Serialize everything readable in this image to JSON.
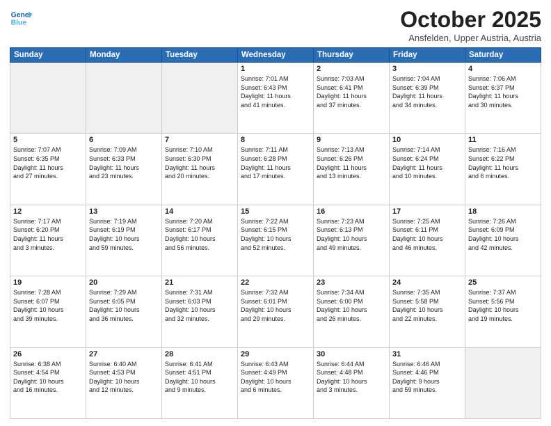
{
  "header": {
    "logo_line1": "General",
    "logo_line2": "Blue",
    "month": "October 2025",
    "location": "Ansfelden, Upper Austria, Austria"
  },
  "weekdays": [
    "Sunday",
    "Monday",
    "Tuesday",
    "Wednesday",
    "Thursday",
    "Friday",
    "Saturday"
  ],
  "weeks": [
    [
      {
        "day": "",
        "info": ""
      },
      {
        "day": "",
        "info": ""
      },
      {
        "day": "",
        "info": ""
      },
      {
        "day": "1",
        "info": "Sunrise: 7:01 AM\nSunset: 6:43 PM\nDaylight: 11 hours\nand 41 minutes."
      },
      {
        "day": "2",
        "info": "Sunrise: 7:03 AM\nSunset: 6:41 PM\nDaylight: 11 hours\nand 37 minutes."
      },
      {
        "day": "3",
        "info": "Sunrise: 7:04 AM\nSunset: 6:39 PM\nDaylight: 11 hours\nand 34 minutes."
      },
      {
        "day": "4",
        "info": "Sunrise: 7:06 AM\nSunset: 6:37 PM\nDaylight: 11 hours\nand 30 minutes."
      }
    ],
    [
      {
        "day": "5",
        "info": "Sunrise: 7:07 AM\nSunset: 6:35 PM\nDaylight: 11 hours\nand 27 minutes."
      },
      {
        "day": "6",
        "info": "Sunrise: 7:09 AM\nSunset: 6:33 PM\nDaylight: 11 hours\nand 23 minutes."
      },
      {
        "day": "7",
        "info": "Sunrise: 7:10 AM\nSunset: 6:30 PM\nDaylight: 11 hours\nand 20 minutes."
      },
      {
        "day": "8",
        "info": "Sunrise: 7:11 AM\nSunset: 6:28 PM\nDaylight: 11 hours\nand 17 minutes."
      },
      {
        "day": "9",
        "info": "Sunrise: 7:13 AM\nSunset: 6:26 PM\nDaylight: 11 hours\nand 13 minutes."
      },
      {
        "day": "10",
        "info": "Sunrise: 7:14 AM\nSunset: 6:24 PM\nDaylight: 11 hours\nand 10 minutes."
      },
      {
        "day": "11",
        "info": "Sunrise: 7:16 AM\nSunset: 6:22 PM\nDaylight: 11 hours\nand 6 minutes."
      }
    ],
    [
      {
        "day": "12",
        "info": "Sunrise: 7:17 AM\nSunset: 6:20 PM\nDaylight: 11 hours\nand 3 minutes."
      },
      {
        "day": "13",
        "info": "Sunrise: 7:19 AM\nSunset: 6:19 PM\nDaylight: 10 hours\nand 59 minutes."
      },
      {
        "day": "14",
        "info": "Sunrise: 7:20 AM\nSunset: 6:17 PM\nDaylight: 10 hours\nand 56 minutes."
      },
      {
        "day": "15",
        "info": "Sunrise: 7:22 AM\nSunset: 6:15 PM\nDaylight: 10 hours\nand 52 minutes."
      },
      {
        "day": "16",
        "info": "Sunrise: 7:23 AM\nSunset: 6:13 PM\nDaylight: 10 hours\nand 49 minutes."
      },
      {
        "day": "17",
        "info": "Sunrise: 7:25 AM\nSunset: 6:11 PM\nDaylight: 10 hours\nand 46 minutes."
      },
      {
        "day": "18",
        "info": "Sunrise: 7:26 AM\nSunset: 6:09 PM\nDaylight: 10 hours\nand 42 minutes."
      }
    ],
    [
      {
        "day": "19",
        "info": "Sunrise: 7:28 AM\nSunset: 6:07 PM\nDaylight: 10 hours\nand 39 minutes."
      },
      {
        "day": "20",
        "info": "Sunrise: 7:29 AM\nSunset: 6:05 PM\nDaylight: 10 hours\nand 36 minutes."
      },
      {
        "day": "21",
        "info": "Sunrise: 7:31 AM\nSunset: 6:03 PM\nDaylight: 10 hours\nand 32 minutes."
      },
      {
        "day": "22",
        "info": "Sunrise: 7:32 AM\nSunset: 6:01 PM\nDaylight: 10 hours\nand 29 minutes."
      },
      {
        "day": "23",
        "info": "Sunrise: 7:34 AM\nSunset: 6:00 PM\nDaylight: 10 hours\nand 26 minutes."
      },
      {
        "day": "24",
        "info": "Sunrise: 7:35 AM\nSunset: 5:58 PM\nDaylight: 10 hours\nand 22 minutes."
      },
      {
        "day": "25",
        "info": "Sunrise: 7:37 AM\nSunset: 5:56 PM\nDaylight: 10 hours\nand 19 minutes."
      }
    ],
    [
      {
        "day": "26",
        "info": "Sunrise: 6:38 AM\nSunset: 4:54 PM\nDaylight: 10 hours\nand 16 minutes."
      },
      {
        "day": "27",
        "info": "Sunrise: 6:40 AM\nSunset: 4:53 PM\nDaylight: 10 hours\nand 12 minutes."
      },
      {
        "day": "28",
        "info": "Sunrise: 6:41 AM\nSunset: 4:51 PM\nDaylight: 10 hours\nand 9 minutes."
      },
      {
        "day": "29",
        "info": "Sunrise: 6:43 AM\nSunset: 4:49 PM\nDaylight: 10 hours\nand 6 minutes."
      },
      {
        "day": "30",
        "info": "Sunrise: 6:44 AM\nSunset: 4:48 PM\nDaylight: 10 hours\nand 3 minutes."
      },
      {
        "day": "31",
        "info": "Sunrise: 6:46 AM\nSunset: 4:46 PM\nDaylight: 9 hours\nand 59 minutes."
      },
      {
        "day": "",
        "info": ""
      }
    ]
  ]
}
